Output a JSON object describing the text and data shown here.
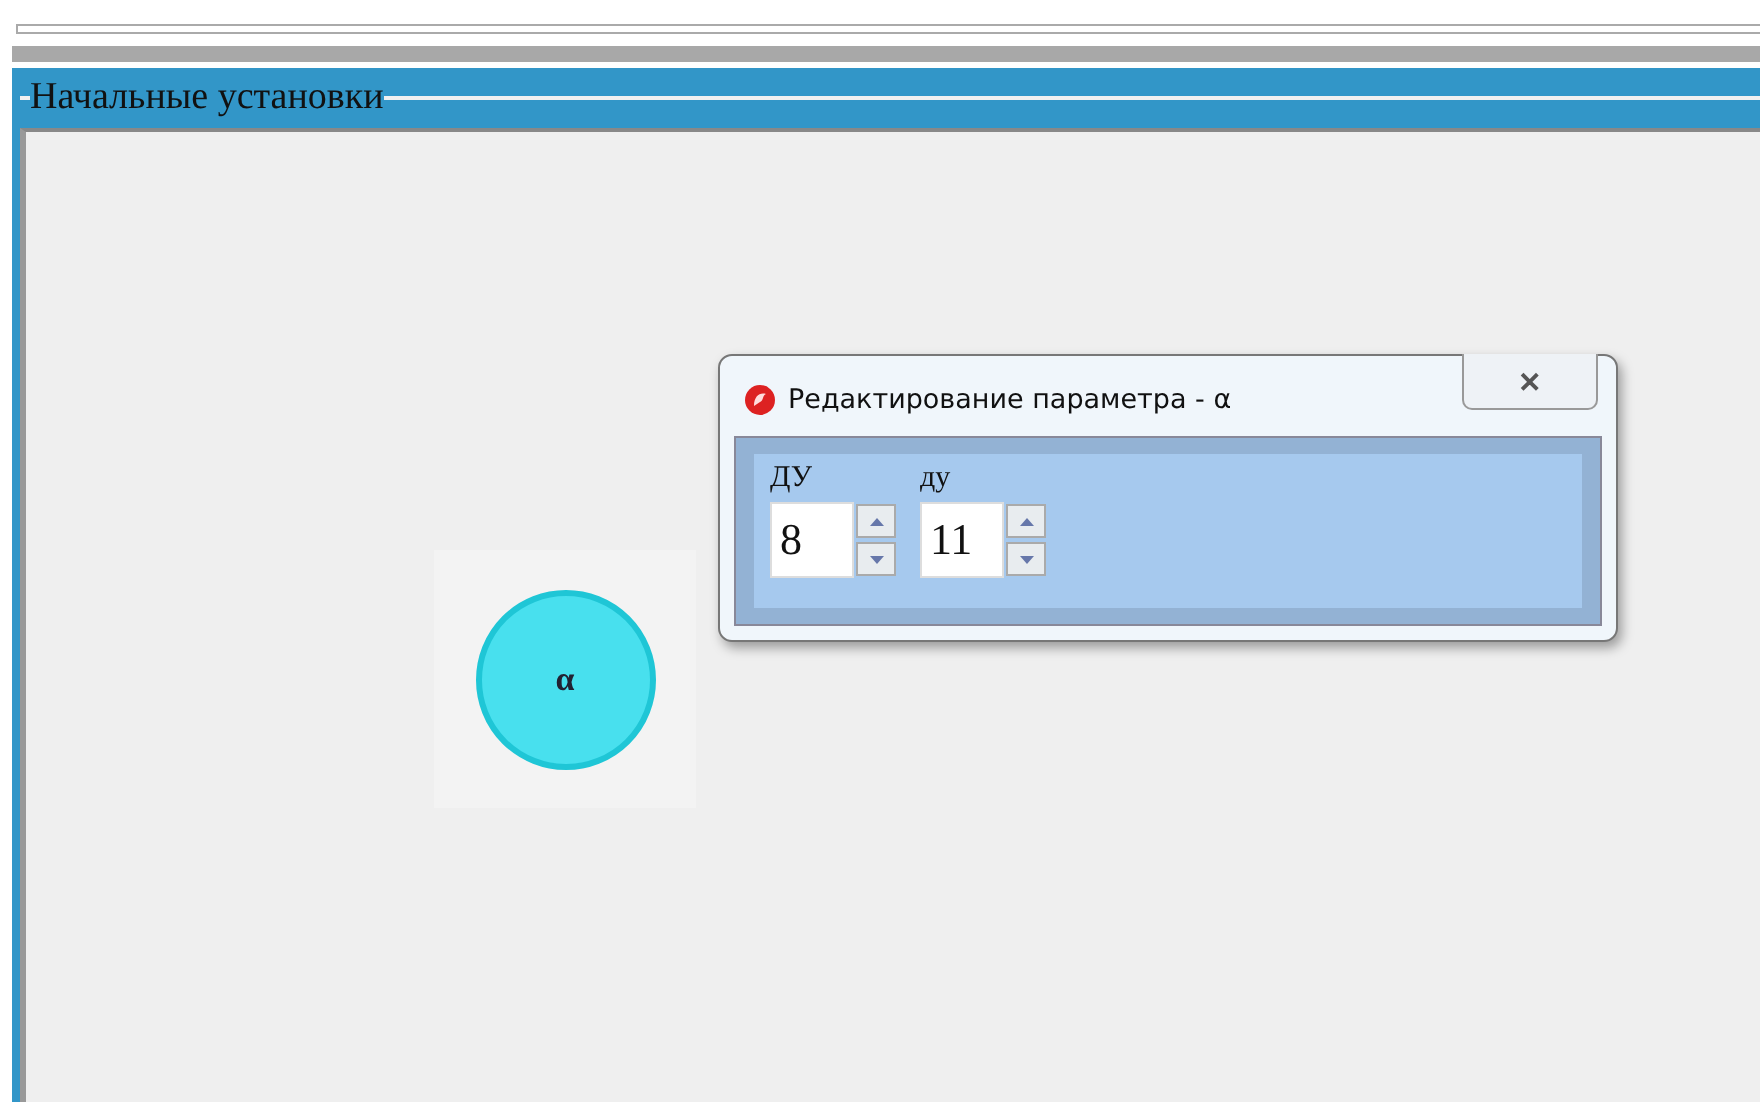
{
  "panel": {
    "title": "Начальные установки"
  },
  "nodes": [
    {
      "label": "α"
    }
  ],
  "dialog": {
    "title": "Редактирование параметра - α",
    "close": "✕",
    "fields": [
      {
        "label": "ДУ",
        "value": "8"
      },
      {
        "label": "ду",
        "value": "11"
      }
    ]
  }
}
